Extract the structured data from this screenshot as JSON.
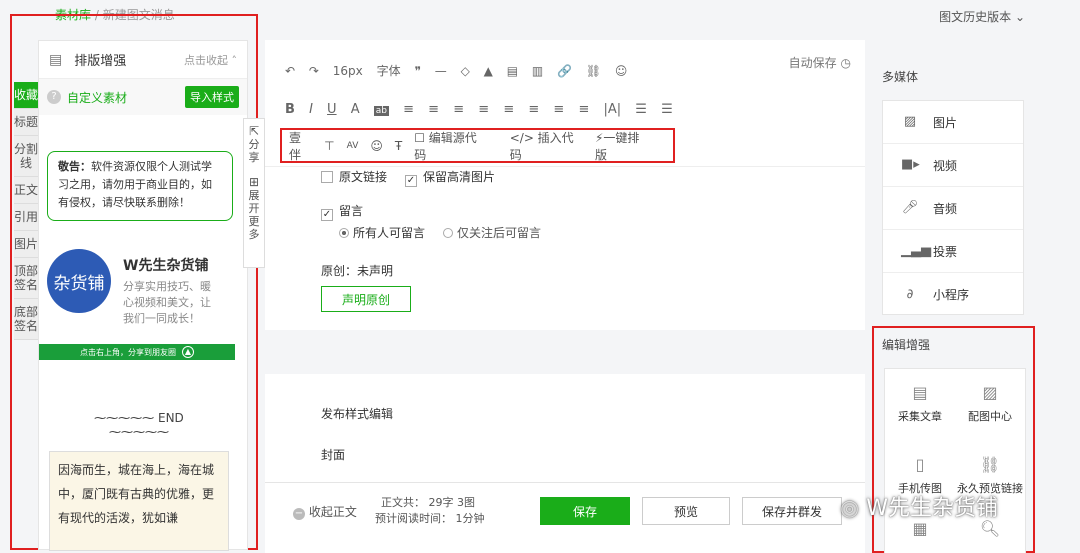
{
  "breadcrumb": {
    "root": "素材库",
    "sep": "/",
    "current": "新建图文消息"
  },
  "history_label": "图文历史版本",
  "left": {
    "header_title": "排版增强",
    "collapse": "点击收起",
    "custom_material": "自定义素材",
    "import_style": "导入样式",
    "tabs": [
      "收藏",
      "标题",
      "分割线",
      "正文",
      "引用",
      "图片",
      "顶部签名",
      "底部签名"
    ],
    "notice_bold": "敬告：",
    "notice_text": "软件资源仅限个人测试学习之用，请勿用于商业目的，如有侵权，请尽快联系删除！",
    "card_logo_text": "杂货铺",
    "card_title": "W先生杂货铺",
    "card_desc": "分享实用技巧、暖心视频和美文，让我们一同成长！",
    "green_bar_text": "点击右上角，分享到朋友圈",
    "divider_text": "END",
    "poem": "因海而生，城在海上，海在城中，厦门既有古典的优雅，更有现代的活泼，犹如谦"
  },
  "side_strip": {
    "share": "分享",
    "expand": "展开更多"
  },
  "editor": {
    "autosave": "自动保存",
    "toolbar1": [
      "↶",
      "↷",
      "16px",
      "字体",
      "❞",
      "—",
      "◇",
      "▲",
      "▤",
      "▥",
      "🔗",
      "⛓",
      "☺"
    ],
    "toolbar2": [
      "B",
      "I",
      "U",
      "A",
      "ab",
      "≡",
      "≡",
      "≡",
      "≡",
      "≡",
      "≡",
      "≡",
      "≡",
      "|A|",
      "☰",
      "☰"
    ],
    "toolbar3": [
      "壹伴",
      "⊤",
      "AV",
      "☺",
      "Ŧ",
      "编辑源代码",
      "</> 插入代码",
      "一键排版"
    ],
    "original_link": "原文链接",
    "keep_hd": "保留高清图片",
    "comment": "留言",
    "comment_all": "所有人可留言",
    "comment_follow": "仅关注后可留言",
    "original_status": "原创：未声明",
    "declare_btn": "声明原创",
    "publish_style": "发布样式编辑",
    "cover": "封面"
  },
  "bottom": {
    "fold_body": "收起正文",
    "stats_line1": "正文共： 29字 3图",
    "stats_line2": "预计阅读时间： 1分钟",
    "save": "保存",
    "preview": "预览",
    "save_publish": "保存并群发"
  },
  "right": {
    "media_title": "多媒体",
    "media_items": [
      "图片",
      "视频",
      "音频",
      "投票",
      "小程序"
    ],
    "enhance_title": "编辑增强",
    "enhance_items": [
      "采集文章",
      "配图中心",
      "手机传图",
      "永久预览链接"
    ]
  },
  "watermark": "W先生杂货铺"
}
